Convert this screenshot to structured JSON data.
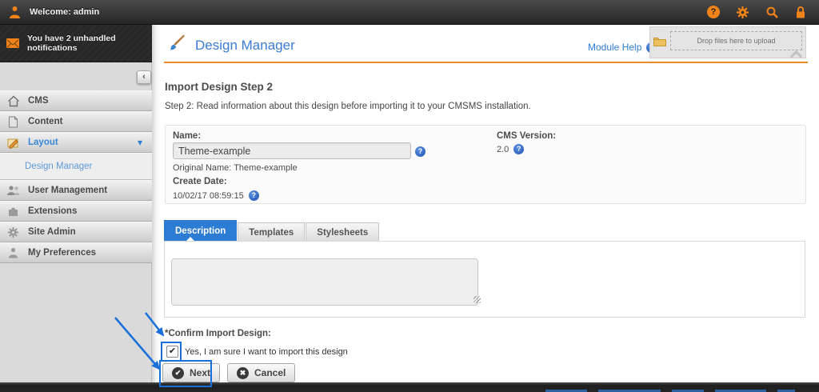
{
  "topbar": {
    "welcome": "Welcome: admin",
    "icons": {
      "help": "help-icon",
      "settings": "settings-icon",
      "search": "search-icon",
      "lock": "lock-icon"
    }
  },
  "notifications": {
    "text": "You have 2 unhandled notifications"
  },
  "sidebar": {
    "collapse_glyph": "‹",
    "items": [
      {
        "label": "CMS",
        "icon": "home-icon"
      },
      {
        "label": "Content",
        "icon": "document-icon"
      },
      {
        "label": "Layout",
        "icon": "layout-icon",
        "active": true,
        "expanded": true
      },
      {
        "label": "Design Manager",
        "sub": true
      },
      {
        "label": "User Management",
        "icon": "users-icon"
      },
      {
        "label": "Extensions",
        "icon": "puzzle-icon"
      },
      {
        "label": "Site Admin",
        "icon": "gear-icon"
      },
      {
        "label": "My Preferences",
        "icon": "user-icon"
      }
    ]
  },
  "header": {
    "title": "Design Manager",
    "module_help": "Module Help",
    "dropzone": "Drop files here to upload"
  },
  "main": {
    "heading": "Import Design Step 2",
    "step_text": "Step 2: Read information about this design before importing it to your CMSMS installation.",
    "fields": {
      "name_label": "Name:",
      "name_value": "Theme-example",
      "original_name": "Original Name: Theme-example",
      "create_date_label": "Create Date:",
      "create_date_value": "10/02/17 08:59:15",
      "cms_version_label": "CMS Version:",
      "cms_version_value": "2.0"
    },
    "tabs": [
      {
        "label": "Description",
        "active": true
      },
      {
        "label": "Templates",
        "active": false
      },
      {
        "label": "Stylesheets",
        "active": false
      }
    ],
    "confirm_label": "*Confirm Import Design:",
    "checkbox_label": "Yes, I am sure I want to import this design",
    "checkbox_checked": true,
    "buttons": {
      "next": "Next",
      "cancel": "Cancel"
    }
  },
  "icons": {
    "check": "✔",
    "cross": "✖",
    "question": "?",
    "chevron_down": "▾",
    "chevron_left": "‹"
  },
  "colors": {
    "accent_orange": "#ec8b2a",
    "icon_orange": "#ef8318",
    "link_blue": "#3a7bd5",
    "active_tab_blue": "#2c7cd4",
    "annotation_blue": "#1b6fd9"
  }
}
